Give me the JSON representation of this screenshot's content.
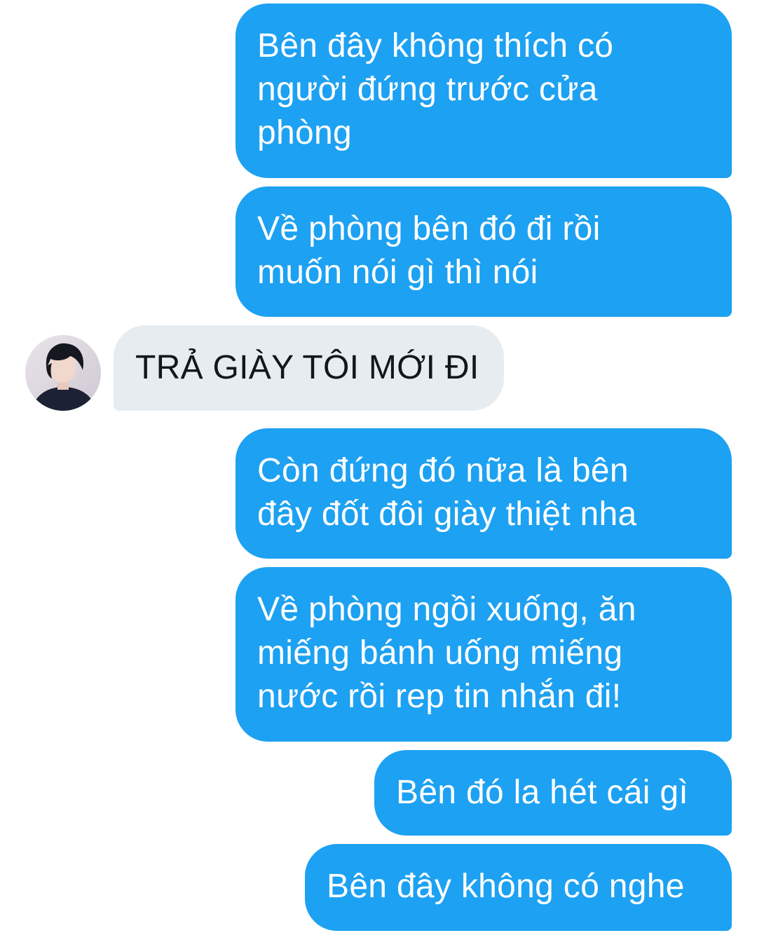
{
  "conversation": {
    "messages": [
      {
        "sender": "me",
        "text": "Bên đây không thích có\nngười đứng trước cửa\nphòng"
      },
      {
        "sender": "me",
        "text": "Về phòng bên đó đi rồi\nmuốn nói gì thì nói"
      },
      {
        "sender": "other",
        "text": "TRẢ GIÀY TÔI MỚI ĐI",
        "avatar_icon": "user-avatar"
      },
      {
        "sender": "me",
        "text": "Còn đứng đó nữa là bên\nđây đốt đôi giày thiệt nha"
      },
      {
        "sender": "me",
        "text": "Về phòng ngồi xuống, ăn\nmiếng bánh uống miếng\nnước rồi rep tin nhắn đi!"
      },
      {
        "sender": "me",
        "text": "Bên đó la hét cái gì"
      },
      {
        "sender": "me",
        "text": "Bên đây không có nghe"
      }
    ]
  },
  "colors": {
    "sent_bubble": "#1da1f2",
    "sent_text": "#ffffff",
    "received_bubble": "#e6ecf0",
    "received_text": "#14171a",
    "background": "#ffffff"
  }
}
